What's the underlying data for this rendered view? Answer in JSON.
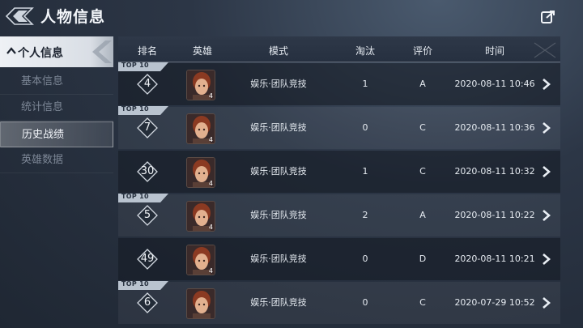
{
  "header": {
    "title": "人物信息"
  },
  "sidebar": {
    "header_label": "个人信息",
    "items": [
      {
        "label": "基本信息",
        "active": false
      },
      {
        "label": "统计信息",
        "active": false
      },
      {
        "label": "历史战绩",
        "active": true
      },
      {
        "label": "英雄数据",
        "active": false
      }
    ]
  },
  "table": {
    "columns": {
      "rank": "排名",
      "hero": "英雄",
      "mode": "模式",
      "eliminations": "淘汰",
      "rating": "评价",
      "time": "时间"
    },
    "rows": [
      {
        "top10": "TOP 10",
        "rank": "4",
        "hero_level": "4",
        "mode": "娱乐·团队竞技",
        "eliminations": "1",
        "rating": "A",
        "time": "2020-08-11 10:46"
      },
      {
        "top10": "TOP 10",
        "rank": "7",
        "hero_level": "4",
        "mode": "娱乐·团队竞技",
        "eliminations": "0",
        "rating": "C",
        "time": "2020-08-11 10:36"
      },
      {
        "top10": "",
        "rank": "30",
        "hero_level": "4",
        "mode": "娱乐·团队竞技",
        "eliminations": "1",
        "rating": "C",
        "time": "2020-08-11 10:32"
      },
      {
        "top10": "TOP 10",
        "rank": "5",
        "hero_level": "4",
        "mode": "娱乐·团队竞技",
        "eliminations": "2",
        "rating": "A",
        "time": "2020-08-11 10:22"
      },
      {
        "top10": "",
        "rank": "49",
        "hero_level": "4",
        "mode": "娱乐·团队竞技",
        "eliminations": "0",
        "rating": "D",
        "time": "2020-08-11 10:21"
      },
      {
        "top10": "TOP 10",
        "rank": "6",
        "hero_level": "",
        "mode": "娱乐·团队竞技",
        "eliminations": "0",
        "rating": "C",
        "time": "2020-07-29 10:52"
      }
    ]
  },
  "icons": {
    "logo": "diamond-logo-icon",
    "exit": "exit-icon",
    "row_action": "chevron-right-icon"
  },
  "colors": {
    "accent": "#bcc6d2",
    "background": "#2c3646",
    "active_bg": "#d9dee5"
  }
}
